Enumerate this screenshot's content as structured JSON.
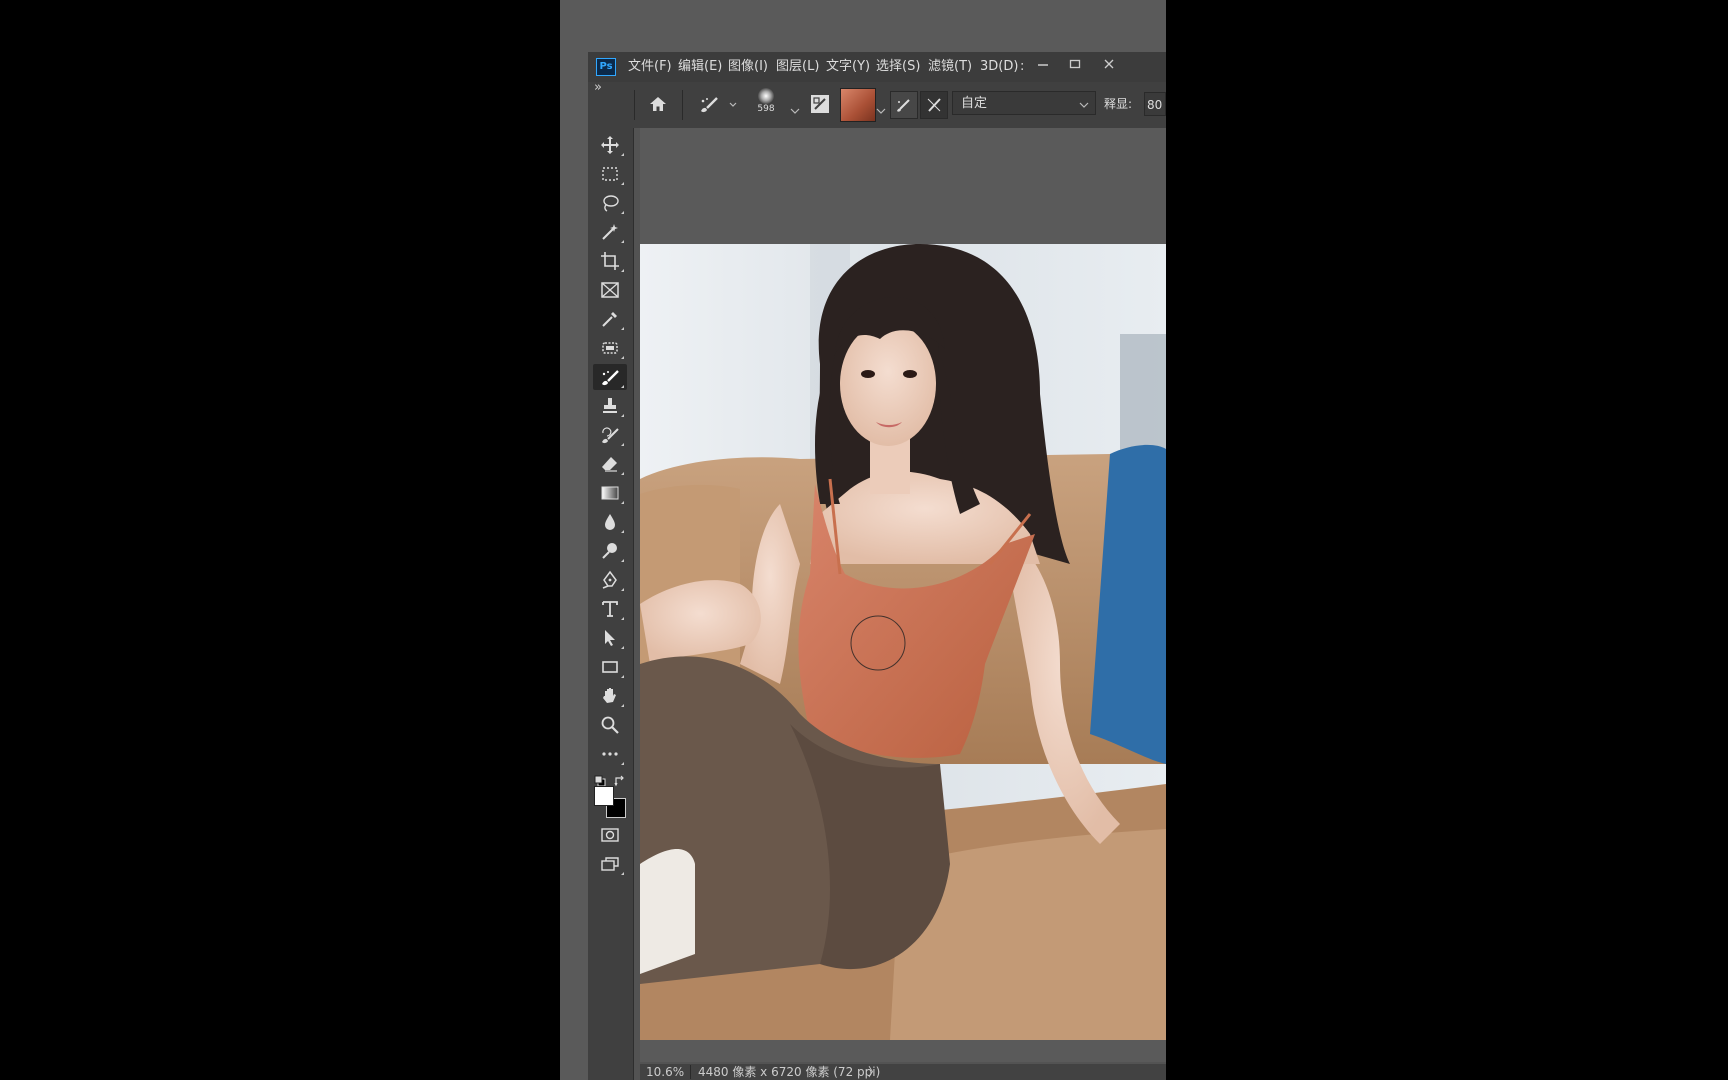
{
  "app": {
    "logo": "Ps",
    "menu": [
      "文件(F)",
      "编辑(E)",
      "图像(I)",
      "图层(L)",
      "文字(Y)",
      "选择(S)",
      "滤镜(T)",
      "3D(D)",
      ":"
    ],
    "window_controls": [
      "minimize-icon",
      "maximize-icon",
      "close-icon"
    ]
  },
  "options_bar": {
    "collapse_glyph": "»",
    "brush_size": "598",
    "mode_value": "自定",
    "param_label": "释显:",
    "param_value": "80"
  },
  "tools": [
    {
      "name": "move-tool",
      "icon": "move-icon"
    },
    {
      "name": "marquee-tool",
      "icon": "marquee-icon"
    },
    {
      "name": "lasso-tool",
      "icon": "lasso-icon"
    },
    {
      "name": "magic-wand-tool",
      "icon": "magic-wand-icon"
    },
    {
      "name": "crop-tool",
      "icon": "crop-icon"
    },
    {
      "name": "frame-tool",
      "icon": "frame-icon"
    },
    {
      "name": "eyedropper-tool",
      "icon": "eyedropper-icon"
    },
    {
      "name": "patch-tool",
      "icon": "patch-icon"
    },
    {
      "name": "healing-brush-tool",
      "icon": "healing-brush-icon",
      "active": true
    },
    {
      "name": "stamp-tool",
      "icon": "stamp-icon"
    },
    {
      "name": "history-brush-tool",
      "icon": "history-brush-icon"
    },
    {
      "name": "eraser-tool",
      "icon": "eraser-icon"
    },
    {
      "name": "gradient-tool",
      "icon": "gradient-icon"
    },
    {
      "name": "blur-tool",
      "icon": "blur-icon"
    },
    {
      "name": "dodge-tool",
      "icon": "dodge-icon"
    },
    {
      "name": "pen-tool",
      "icon": "pen-icon"
    },
    {
      "name": "type-tool",
      "icon": "type-icon"
    },
    {
      "name": "path-selection-tool",
      "icon": "path-selection-icon"
    },
    {
      "name": "rectangle-tool",
      "icon": "rectangle-icon"
    },
    {
      "name": "hand-tool",
      "icon": "hand-icon"
    },
    {
      "name": "zoom-tool",
      "icon": "zoom-icon"
    },
    {
      "name": "more-tools",
      "icon": "more-icon"
    }
  ],
  "colors": {
    "foreground": "#ffffff",
    "background": "#000000",
    "ui_dark": "#3c3c3c",
    "canvas_bg": "#5a5a5a"
  },
  "status": {
    "zoom": "10.6%",
    "doc_info": "4480 像素 x 6720 像素 (72 ppi)",
    "arrow": "〉"
  }
}
